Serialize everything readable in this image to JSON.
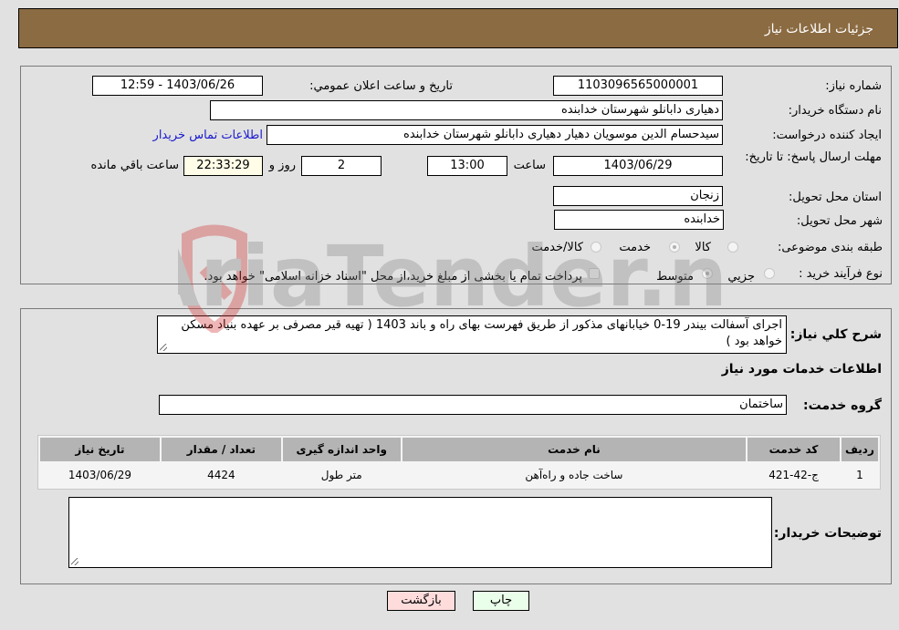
{
  "header": {
    "title": "جزئیات اطلاعات نیاز"
  },
  "fields": {
    "need_number_label": "شماره نیاز:",
    "need_number": "1103096565000001",
    "announce_label": "تاریخ و ساعت اعلان عمومي:",
    "announce_value": "1403/06/26 - 12:59",
    "buyer_org_label": "نام دستگاه خریدار:",
    "buyer_org": "دهیاری دابانلو شهرستان خدابنده",
    "creator_label": "ایجاد کننده درخواست:",
    "creator": "سیدحسام الدین موسویان دهیار دهیاری دابانلو شهرستان خدابنده",
    "contact_link": "اطلاعات تماس خریدار",
    "deadline_label": "مهلت ارسال پاسخ: تا تاریخ:",
    "deadline_date": "1403/06/29",
    "time_label": "ساعت",
    "deadline_time": "13:00",
    "days_value": "2",
    "days_label": "روز و",
    "remaining_time": "22:33:29",
    "remaining_label": "ساعت باقي مانده",
    "province_label": "استان محل تحویل:",
    "province": "زنجان",
    "city_label": "شهر محل تحویل:",
    "city": "خدابنده",
    "category_label": "طبقه بندی موضوعی:",
    "category_options": [
      "کالا",
      "خدمت",
      "کالا/خدمت"
    ],
    "category_selected": "خدمت",
    "process_label": "نوع فرآیند خرید :",
    "process_options": [
      "جزيي",
      "متوسط"
    ],
    "process_selected": "متوسط",
    "treasury_note": "پرداخت تمام یا بخشی از مبلغ خرید،از محل \"اسناد خزانه اسلامی\" خواهد بود."
  },
  "details": {
    "description_label": "شرح کلي نیاز:",
    "description": "اجرای آسفالت بیندر 19-0 خیابانهای مذکور از طریق فهرست بهای راه و باند 1403 ( تهیه قیر مصرفی بر عهده بنیاد مسکن خواهد بود )",
    "services_heading": "اطلاعات خدمات مورد نیاز",
    "service_group_label": "گروه خدمت:",
    "service_group": "ساختمان",
    "table": {
      "headers": [
        "ردیف",
        "کد خدمت",
        "نام خدمت",
        "واحد اندازه گیری",
        "تعداد / مقدار",
        "تاریخ نیاز"
      ],
      "rows": [
        [
          "1",
          "ج-42-421",
          "ساخت جاده و راه‌آهن",
          "متر طول",
          "4424",
          "1403/06/29"
        ]
      ]
    },
    "buyer_notes_label": "توضیحات خریدار:",
    "buyer_notes": ""
  },
  "buttons": {
    "print": "چاپ",
    "back": "بازگشت"
  },
  "watermark": {
    "text": "AriaTender.neT"
  },
  "colors": {
    "header_bg": "#8b6b42",
    "print_bg": "#eaffea",
    "back_bg": "#ffdcdc",
    "link": "#1a1ad0"
  }
}
